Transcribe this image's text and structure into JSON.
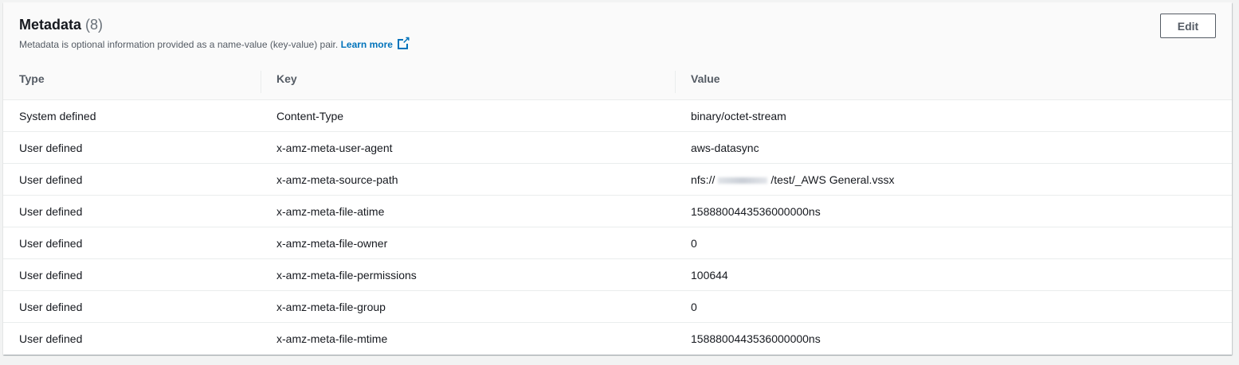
{
  "header": {
    "title": "Metadata",
    "count": "(8)",
    "description": "Metadata is optional information provided as a name-value (key-value) pair.",
    "learn_more": "Learn more",
    "edit_label": "Edit"
  },
  "columns": [
    "Type",
    "Key",
    "Value"
  ],
  "rows": [
    {
      "type": "System defined",
      "key": "Content-Type",
      "value": "binary/octet-stream"
    },
    {
      "type": "User defined",
      "key": "x-amz-meta-user-agent",
      "value": "aws-datasync"
    },
    {
      "type": "User defined",
      "key": "x-amz-meta-source-path",
      "value_prefix": "nfs://",
      "value_suffix": "/test/_AWS General.vssx"
    },
    {
      "type": "User defined",
      "key": "x-amz-meta-file-atime",
      "value": "1588800443536000000ns"
    },
    {
      "type": "User defined",
      "key": "x-amz-meta-file-owner",
      "value": "0"
    },
    {
      "type": "User defined",
      "key": "x-amz-meta-file-permissions",
      "value": "100644"
    },
    {
      "type": "User defined",
      "key": "x-amz-meta-file-group",
      "value": "0"
    },
    {
      "type": "User defined",
      "key": "x-amz-meta-file-mtime",
      "value": "1588800443536000000ns"
    }
  ]
}
